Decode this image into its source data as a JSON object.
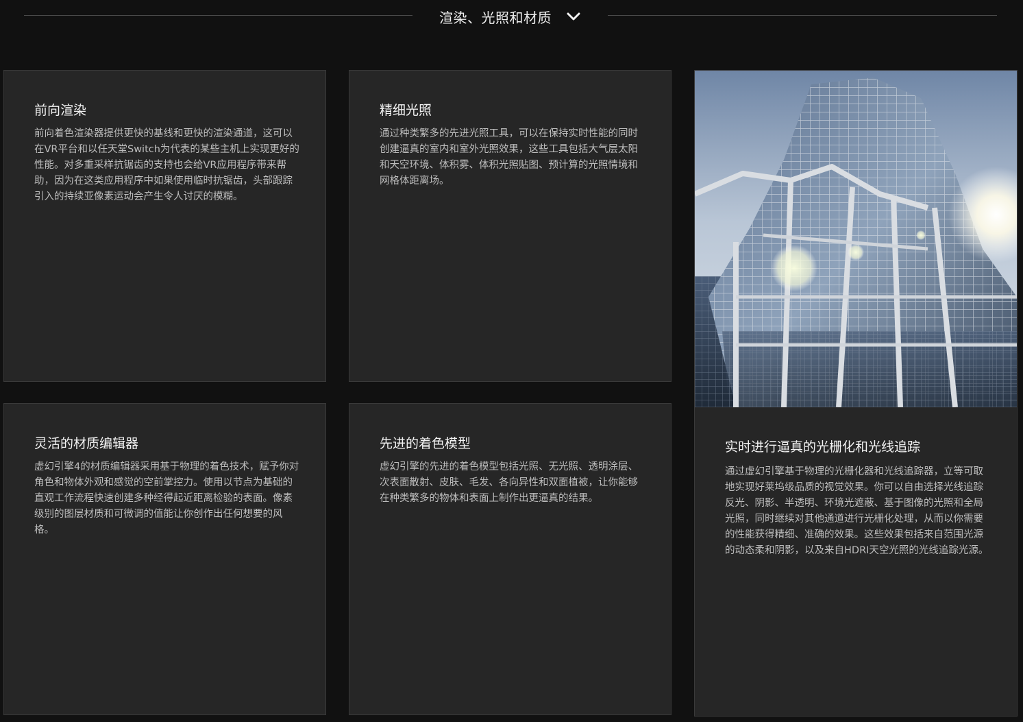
{
  "section": {
    "title": "渲染、光照和材质",
    "toggle_icon": "chevron-down-icon"
  },
  "cards": {
    "forward": {
      "title": "前向渲染",
      "body": "前向着色渲染器提供更快的基线和更快的渲染通道，这可以在VR平台和以任天堂Switch为代表的某些主机上实现更好的性能。对多重采样抗锯齿的支持也会给VR应用程序带来帮助，因为在这类应用程序中如果使用临时抗锯齿，头部跟踪引入的持续亚像素运动会产生令人讨厌的模糊。"
    },
    "lighting": {
      "title": "精细光照",
      "body": "通过种类繁多的先进光照工具，可以在保持实时性能的同时创建逼真的室内和室外光照效果，这些工具包括大气层太阳和天空环境、体积雾、体积光照贴图、预计算的光照情境和网格体距离场。"
    },
    "material": {
      "title": "灵活的材质编辑器",
      "body": "虚幻引擎4的材质编辑器采用基于物理的着色技术，赋予你对角色和物体外观和感觉的空前掌控力。使用以节点为基础的直观工作流程快速创建多种经得起近距离检验的表面。像素级别的图层材质和可微调的值能让你创作出任何想要的风格。"
    },
    "shading": {
      "title": "先进的着色模型",
      "body": "虚幻引擎的先进的着色模型包括光照、无光照、透明涂层、次表面散射、皮肤、毛发、各向异性和双面植被，让你能够在种类繁多的物体和表面上制作出更逼真的结果。"
    },
    "raytrace": {
      "title": "实时进行逼真的光栅化和光线追踪",
      "body": "通过虚幻引擎基于物理的光栅化器和光线追踪器，立等可取地实现好莱坞级品质的视觉效果。你可以自由选择光线追踪反光、阴影、半透明、环境光遮蔽、基于图像的光照和全局光照，同时继续对其他通道进行光栅化处理，从而以你需要的性能获得精细、准确的效果。这些效果包括来自范围光源的动态柔和阴影，以及来自HDRI天空光照的光线追踪光源。",
      "image_icon": "skyscraper-image"
    }
  },
  "colors": {
    "background": "#111111",
    "card": "#262626",
    "card_border": "#3a3a3a",
    "title_text": "#f2f2f2",
    "body_text": "#bdbdbd"
  }
}
